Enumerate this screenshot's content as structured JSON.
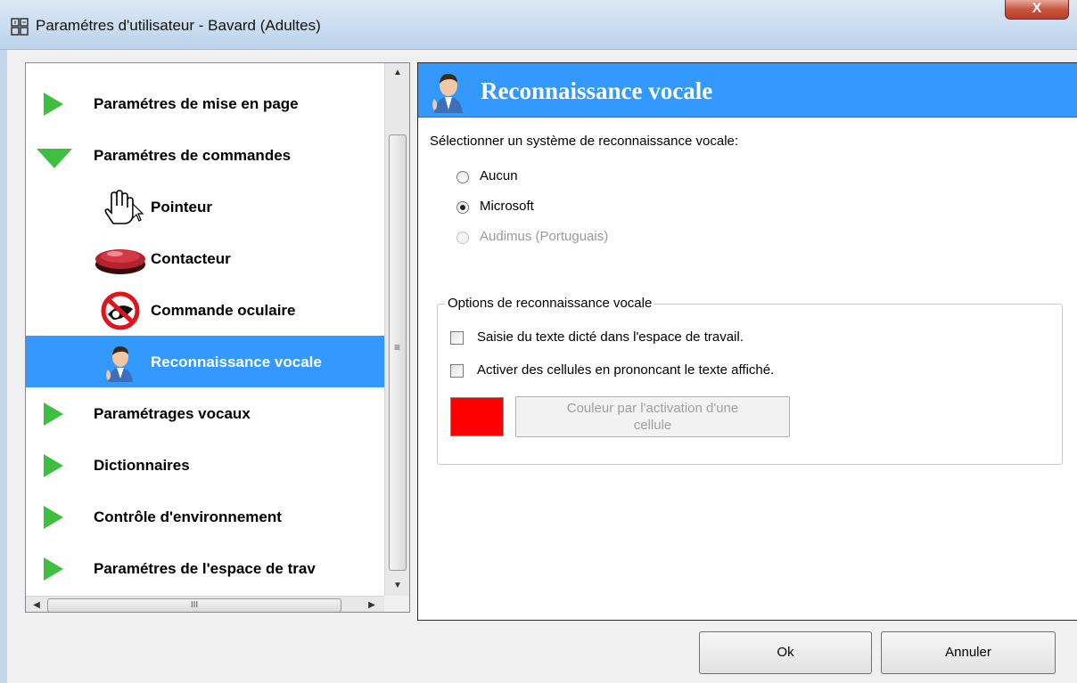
{
  "window": {
    "title": "Paramétres d'utilisateur - Bavard (Adultes)",
    "close_label": "X",
    "icon": "app-grid-icon"
  },
  "tree": {
    "items": [
      {
        "label": "Paramétres de mise en page",
        "expander": "collapsed",
        "icon": "green-arrow-right-icon"
      },
      {
        "label": "Paramétres de commandes",
        "expander": "expanded",
        "icon": "green-arrow-down-icon"
      },
      {
        "label": "Pointeur",
        "icon": "hand-pointer-icon"
      },
      {
        "label": "Contacteur",
        "icon": "switch-button-icon"
      },
      {
        "label": "Commande oculaire",
        "icon": "eye-gaze-disabled-icon"
      },
      {
        "label": "Reconnaissance vocale",
        "icon": "speaking-person-icon",
        "selected": true
      },
      {
        "label": "Paramétrages vocaux",
        "expander": "collapsed",
        "icon": "green-arrow-right-icon"
      },
      {
        "label": "Dictionnaires",
        "expander": "collapsed",
        "icon": "green-arrow-right-icon"
      },
      {
        "label": "Contrôle d'environnement",
        "expander": "collapsed",
        "icon": "green-arrow-right-icon"
      },
      {
        "label": "Paramétres de l'espace de trav",
        "expander": "collapsed",
        "icon": "green-arrow-right-icon"
      }
    ],
    "scroll_up": "▲",
    "scroll_down": "▼",
    "scroll_left": "◀",
    "scroll_right": "▶",
    "vgrip": "≡",
    "hgrip": "III"
  },
  "panel": {
    "title": "Reconnaissance vocale",
    "prompt": "Sélectionner un système de reconnaissance vocale:",
    "radios": [
      {
        "label": "Aucun",
        "checked": false,
        "disabled": false
      },
      {
        "label": "Microsoft",
        "checked": true,
        "disabled": false
      },
      {
        "label": "Audimus (Portuguais)",
        "checked": false,
        "disabled": true
      }
    ],
    "options_group": {
      "legend": "Options de reconnaissance vocale",
      "checkboxes": [
        {
          "label": "Saisie du texte dicté dans l'espace de travail.",
          "checked": false
        },
        {
          "label": "Activer des cellules en prononcant le texte affiché.",
          "checked": false
        }
      ],
      "swatch_color": "#ff0000",
      "color_button_line1": "Couleur par l'activation d'une",
      "color_button_line2": "cellule"
    }
  },
  "buttons": {
    "ok": "Ok",
    "cancel": "Annuler"
  },
  "colors": {
    "selection": "#3399ff",
    "expander_green": "#3fbf3f",
    "header_blue": "#3399ff"
  }
}
